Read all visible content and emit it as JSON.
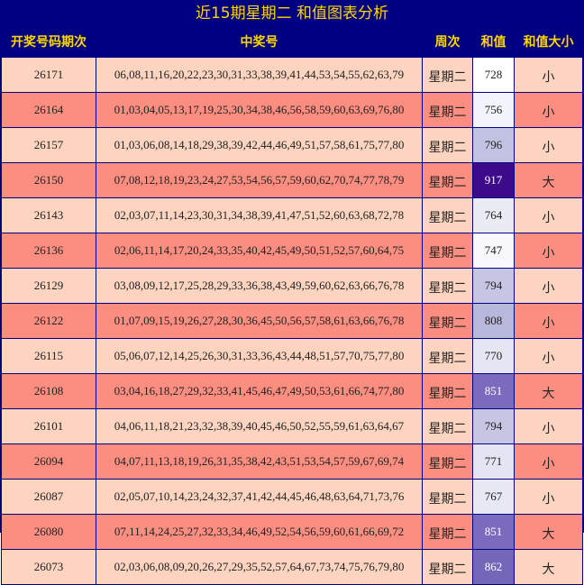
{
  "title": "近15期星期二 和值图表分析",
  "headers": [
    "开奖号码期次",
    "中奖号",
    "周次",
    "和值",
    "和值大小"
  ],
  "rows": [
    {
      "issue": "26171",
      "numbers": "06,08,11,16,20,22,23,30,31,33,38,39,41,44,53,54,55,62,63,79",
      "weekday": "星期二",
      "sum": "728",
      "size": "小",
      "sum_bg": "#ffffff",
      "sum_color": "#222222"
    },
    {
      "issue": "26164",
      "numbers": "01,03,04,05,13,17,19,25,30,34,38,46,56,58,59,60,63,69,76,80",
      "weekday": "星期二",
      "sum": "756",
      "size": "小",
      "sum_bg": "#f3f3fb",
      "sum_color": "#222222"
    },
    {
      "issue": "26157",
      "numbers": "01,03,06,08,14,18,29,38,39,42,44,46,49,51,57,58,61,75,77,80",
      "weekday": "星期二",
      "sum": "796",
      "size": "小",
      "sum_bg": "#c2c2e2",
      "sum_color": "#222222"
    },
    {
      "issue": "26150",
      "numbers": "07,08,12,18,19,23,24,27,53,54,56,57,59,60,62,70,74,77,78,79",
      "weekday": "星期二",
      "sum": "917",
      "size": "大",
      "sum_bg": "#3d0a8a",
      "sum_color": "#ffffff"
    },
    {
      "issue": "26143",
      "numbers": "02,03,07,11,14,23,30,31,34,38,39,41,47,51,52,60,63,68,72,78",
      "weekday": "星期二",
      "sum": "764",
      "size": "小",
      "sum_bg": "#ebebf6",
      "sum_color": "#222222"
    },
    {
      "issue": "26136",
      "numbers": "02,06,11,14,17,20,24,33,35,40,42,45,49,50,51,52,57,60,64,75",
      "weekday": "星期二",
      "sum": "747",
      "size": "小",
      "sum_bg": "#f7f7fc",
      "sum_color": "#222222"
    },
    {
      "issue": "26129",
      "numbers": "03,08,09,12,17,25,28,29,33,36,38,43,49,59,60,62,63,66,76,78",
      "weekday": "星期二",
      "sum": "794",
      "size": "小",
      "sum_bg": "#c6c6e4",
      "sum_color": "#222222"
    },
    {
      "issue": "26122",
      "numbers": "01,07,09,15,19,26,27,28,30,36,45,50,56,57,58,61,63,66,76,78",
      "weekday": "星期二",
      "sum": "808",
      "size": "小",
      "sum_bg": "#b8b8dd",
      "sum_color": "#222222"
    },
    {
      "issue": "26115",
      "numbers": "05,06,07,12,14,25,26,30,31,33,36,43,44,48,51,57,70,75,77,80",
      "weekday": "星期二",
      "sum": "770",
      "size": "小",
      "sum_bg": "#e5e5f3",
      "sum_color": "#222222"
    },
    {
      "issue": "26108",
      "numbers": "03,04,16,18,27,29,32,33,41,45,46,47,49,50,53,61,66,74,77,80",
      "weekday": "星期二",
      "sum": "851",
      "size": "大",
      "sum_bg": "#7b6bbf",
      "sum_color": "#ffffff"
    },
    {
      "issue": "26101",
      "numbers": "04,06,11,18,21,23,32,38,39,40,45,46,50,52,55,59,61,63,64,67",
      "weekday": "星期二",
      "sum": "794",
      "size": "小",
      "sum_bg": "#c6c6e4",
      "sum_color": "#222222"
    },
    {
      "issue": "26094",
      "numbers": "04,07,11,13,18,19,26,31,35,38,42,43,51,53,54,57,59,67,69,74",
      "weekday": "星期二",
      "sum": "771",
      "size": "小",
      "sum_bg": "#e4e4f2",
      "sum_color": "#222222"
    },
    {
      "issue": "26087",
      "numbers": "02,05,07,10,14,23,24,32,37,41,42,44,45,46,48,63,64,71,73,76",
      "weekday": "星期二",
      "sum": "767",
      "size": "小",
      "sum_bg": "#e8e8f5",
      "sum_color": "#222222"
    },
    {
      "issue": "26080",
      "numbers": "07,11,14,24,25,27,32,33,34,46,49,52,54,56,59,60,61,66,69,72",
      "weekday": "星期二",
      "sum": "851",
      "size": "大",
      "sum_bg": "#7b6bbf",
      "sum_color": "#ffffff"
    },
    {
      "issue": "26073",
      "numbers": "02,03,06,08,09,20,26,27,29,35,52,57,64,67,73,74,75,76,79,80",
      "weekday": "星期二",
      "sum": "862",
      "size": "大",
      "sum_bg": "#7466b8",
      "sum_color": "#ffffff"
    }
  ]
}
